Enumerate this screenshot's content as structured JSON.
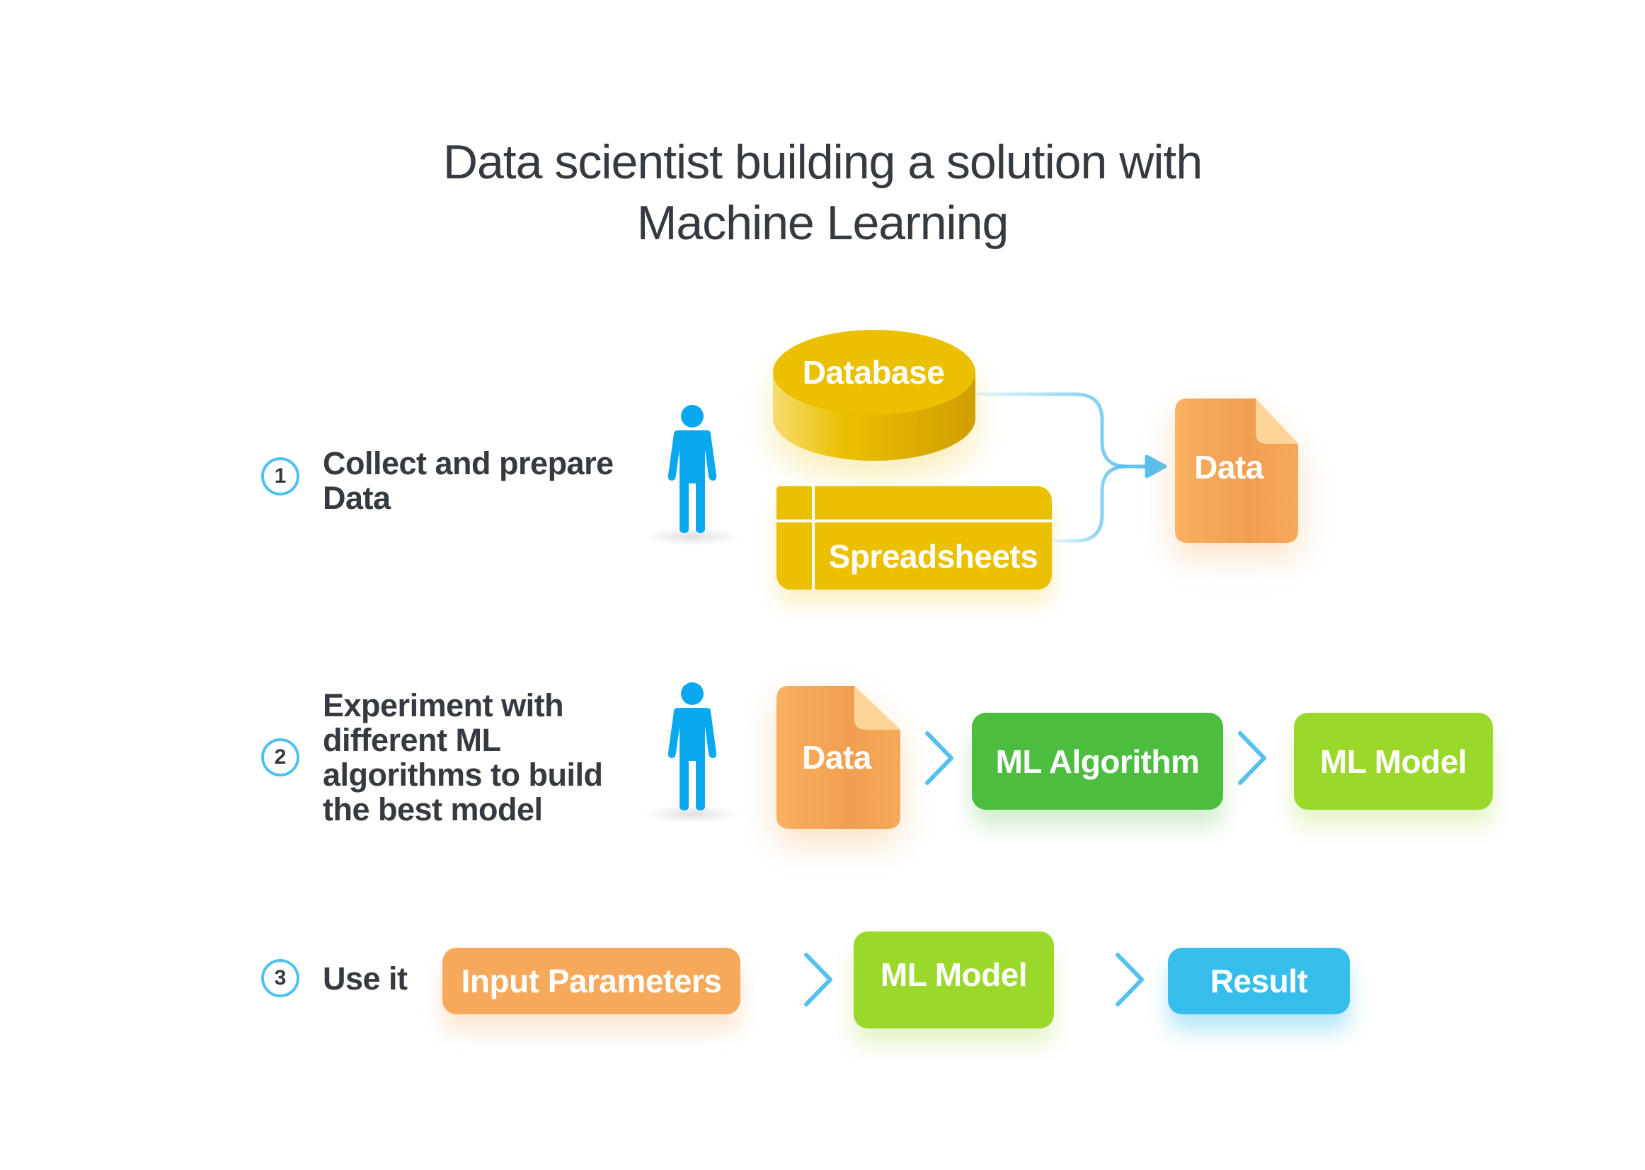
{
  "title": {
    "line1": "Data scientist building a solution with",
    "line2": "Machine Learning"
  },
  "colors": {
    "text_dark": "#343a40",
    "step_circle": "#4fc1f0",
    "person": "#0aa8ee",
    "database_yellow": "#ebc000",
    "data_orange": "#f6a95a",
    "ml_algorithm_green": "#4dbd40",
    "ml_model_lime": "#9ad82a",
    "result_blue": "#36bdec",
    "arrow_blue": "#56c0ee"
  },
  "steps": [
    {
      "number": "1",
      "text_lines": [
        "Collect and prepare",
        "Data"
      ],
      "icons": [
        "person-icon"
      ],
      "nodes": {
        "database": "Database",
        "spreadsheets": "Spreadsheets",
        "output": "Data"
      }
    },
    {
      "number": "2",
      "text_lines": [
        "Experiment with",
        "different ML",
        "algorithms to build",
        "the best model"
      ],
      "icons": [
        "person-icon"
      ],
      "nodes": {
        "input": "Data",
        "algorithm": "ML Algorithm",
        "model": "ML Model"
      }
    },
    {
      "number": "3",
      "text_lines": [
        "Use it"
      ],
      "nodes": {
        "input": "Input Parameters",
        "model": "ML Model",
        "result": "Result"
      }
    }
  ]
}
